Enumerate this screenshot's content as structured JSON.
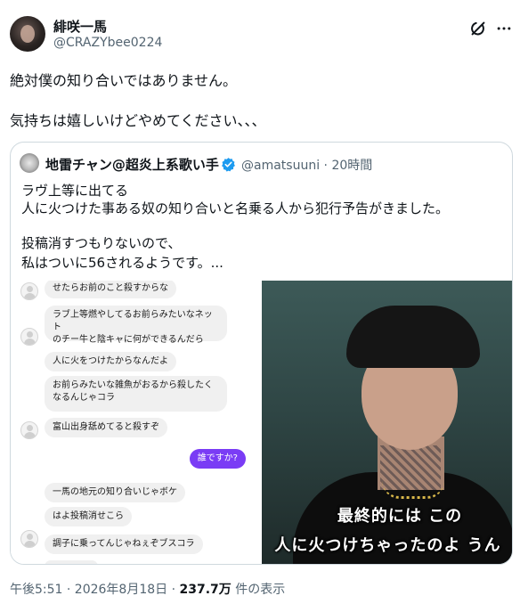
{
  "author": {
    "name": "緋咲一馬",
    "handle": "@CRAZYbee0224"
  },
  "post": {
    "line1": "絶対僕の知り合いではありません。",
    "line2": "気持ちは嬉しいけどやめてください、、、"
  },
  "quote": {
    "name": "地雷チャン@超炎上系歌い手",
    "handle_time": "@amatsuuni · 20時間",
    "lines": [
      "ラヴ上等に出てる",
      "人に火つけた事ある奴の知り合いと名乗る人から犯行予告がきました。",
      "投稿消すつもりないので、",
      "私はついに56されるようです。..."
    ],
    "chat": [
      {
        "text": "せたらお前のこと殺すからな",
        "from": "other"
      },
      {
        "text": "ラブ上等燃やしてるお前らみたいなネット",
        "from": "other"
      },
      {
        "text": "のチー牛と陰キャに何ができるんだら",
        "from": "other"
      },
      {
        "text": "人に火をつけたからなんだよ",
        "from": "other"
      },
      {
        "text": "お前らみたいな雑魚がおるから殺したく",
        "from": "other"
      },
      {
        "text": "なるんじゃコラ",
        "from": "other"
      },
      {
        "text": "富山出身舐めてると殺すぞ",
        "from": "other"
      },
      {
        "text": "誰ですか?",
        "from": "me"
      },
      {
        "text": "一馬の地元の知り合いじゃボケ",
        "from": "other"
      },
      {
        "text": "はよ投稿消せこら",
        "from": "other"
      },
      {
        "text": "調子に乗ってんじゃねぇぞブスコラ",
        "from": "other"
      }
    ],
    "subtitle1": "最終的には この",
    "subtitle2": "人に火つけちゃったのよ うん"
  },
  "footer": {
    "time_date": "午後5:51 · 2026年8月18日 · ",
    "views": "237.7万",
    "views_suffix": " 件の表示"
  },
  "icons": {
    "grok": "grok-icon",
    "more": "more-icon",
    "verified": "verified-badge-icon"
  },
  "colors": {
    "accent_blue": "#1d9bf0",
    "my_bubble": "#7a3cf5"
  }
}
